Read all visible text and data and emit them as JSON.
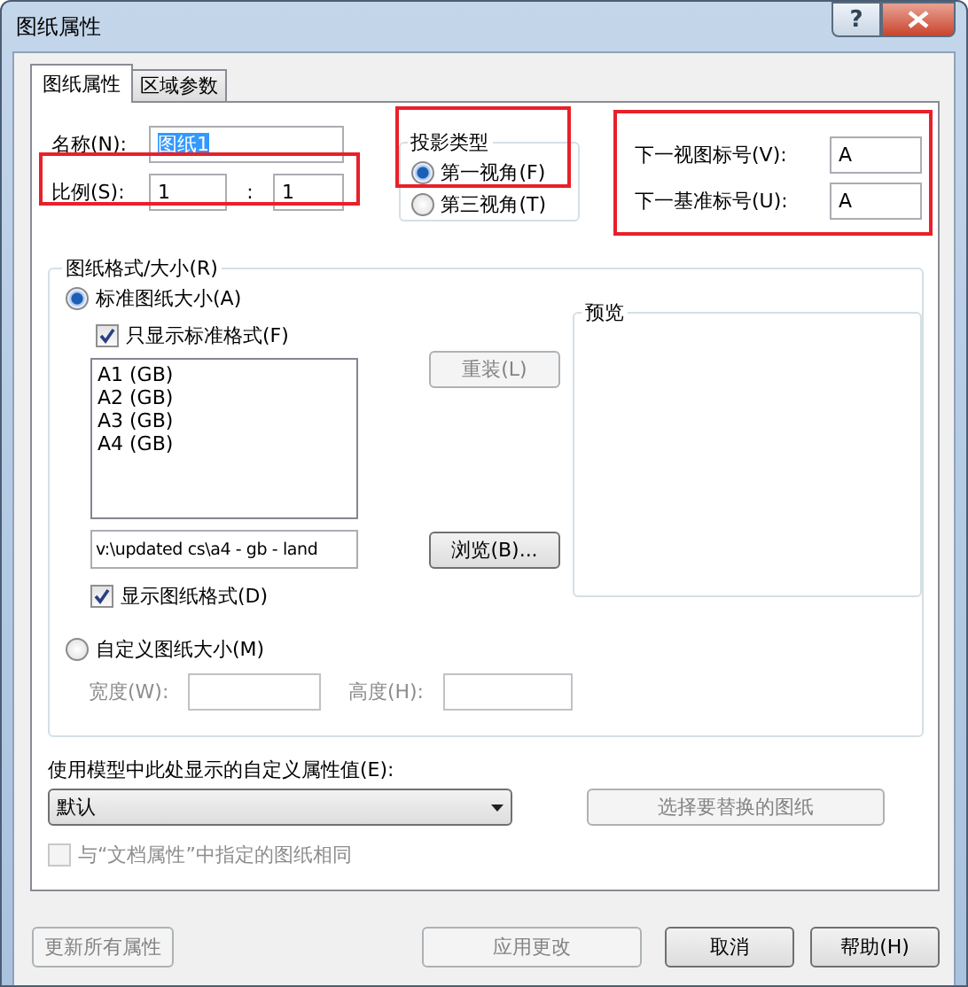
{
  "window": {
    "title": "图纸属性",
    "help_button": "?"
  },
  "tabs": [
    {
      "label": "图纸属性",
      "selected": true
    },
    {
      "label": "区域参数",
      "selected": false
    }
  ],
  "name": {
    "label": "名称(N):",
    "value": "图纸1",
    "text_selected": true
  },
  "scale": {
    "label": "比例(S):",
    "numerator": "1",
    "separator": ":",
    "denominator": "1",
    "highlighted": true
  },
  "projection": {
    "title": "投影类型",
    "highlighted": true,
    "options": [
      {
        "label": "第一视角(F)",
        "selected": true
      },
      {
        "label": "第三视角(T)",
        "selected": false
      }
    ]
  },
  "next_labels": {
    "highlighted": true,
    "items": [
      {
        "label": "下一视图标号(V):",
        "value": "A"
      },
      {
        "label": "下一基准标号(U):",
        "value": "A"
      }
    ]
  },
  "sheet_format": {
    "title": "图纸格式/大小(R)",
    "standard": {
      "label": "标准图纸大小(A)",
      "selected": true
    },
    "only_standard": {
      "label": "只显示标准格式(F)",
      "checked": true
    },
    "sizes": [
      "A1 (GB)",
      "A2 (GB)",
      "A3 (GB)",
      "A4 (GB)"
    ],
    "reload_button": {
      "label": "重装(L)",
      "disabled": true
    },
    "path": "v:\\updated cs\\a4 - gb - land",
    "browse_button": {
      "label": "浏览(B)...",
      "disabled": false
    },
    "show_format": {
      "label": "显示图纸格式(D)",
      "checked": true
    },
    "custom": {
      "label": "自定义图纸大小(M)",
      "selected": false
    },
    "width_label": "宽度(W):",
    "height_label": "高度(H):",
    "preview_title": "预览"
  },
  "custom_property": {
    "label": "使用模型中此处显示的自定义属性值(E):",
    "value": "默认",
    "replace_button": {
      "label": "选择要替换的图纸",
      "disabled": true
    },
    "same_as_doc": {
      "label": "与“文档属性”中指定的图纸相同",
      "checked": false,
      "disabled": true
    }
  },
  "footer_buttons": [
    {
      "label": "更新所有属性",
      "disabled": true
    },
    {
      "label": "应用更改",
      "disabled": true
    },
    {
      "label": "取消",
      "disabled": false
    },
    {
      "label": "帮助(H)",
      "disabled": false
    }
  ]
}
